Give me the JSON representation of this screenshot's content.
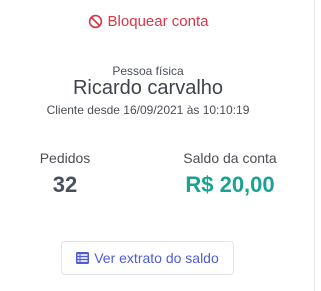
{
  "actions": {
    "block_account_label": "Bloquear conta",
    "block_icon": "ban-icon",
    "statement_button_label": "Ver extrato do saldo",
    "statement_icon": "list-icon"
  },
  "client": {
    "type": "Pessoa física",
    "name": "Ricardo carvalho",
    "since": "Cliente desde 16/09/2021 às 10:10:19"
  },
  "stats": {
    "orders_label": "Pedidos",
    "orders_value": "32",
    "balance_label": "Saldo da conta",
    "balance_value": "R$ 20,00"
  },
  "colors": {
    "danger": "#dc3545",
    "balance": "#1aa391",
    "link": "#4f5bd5"
  }
}
